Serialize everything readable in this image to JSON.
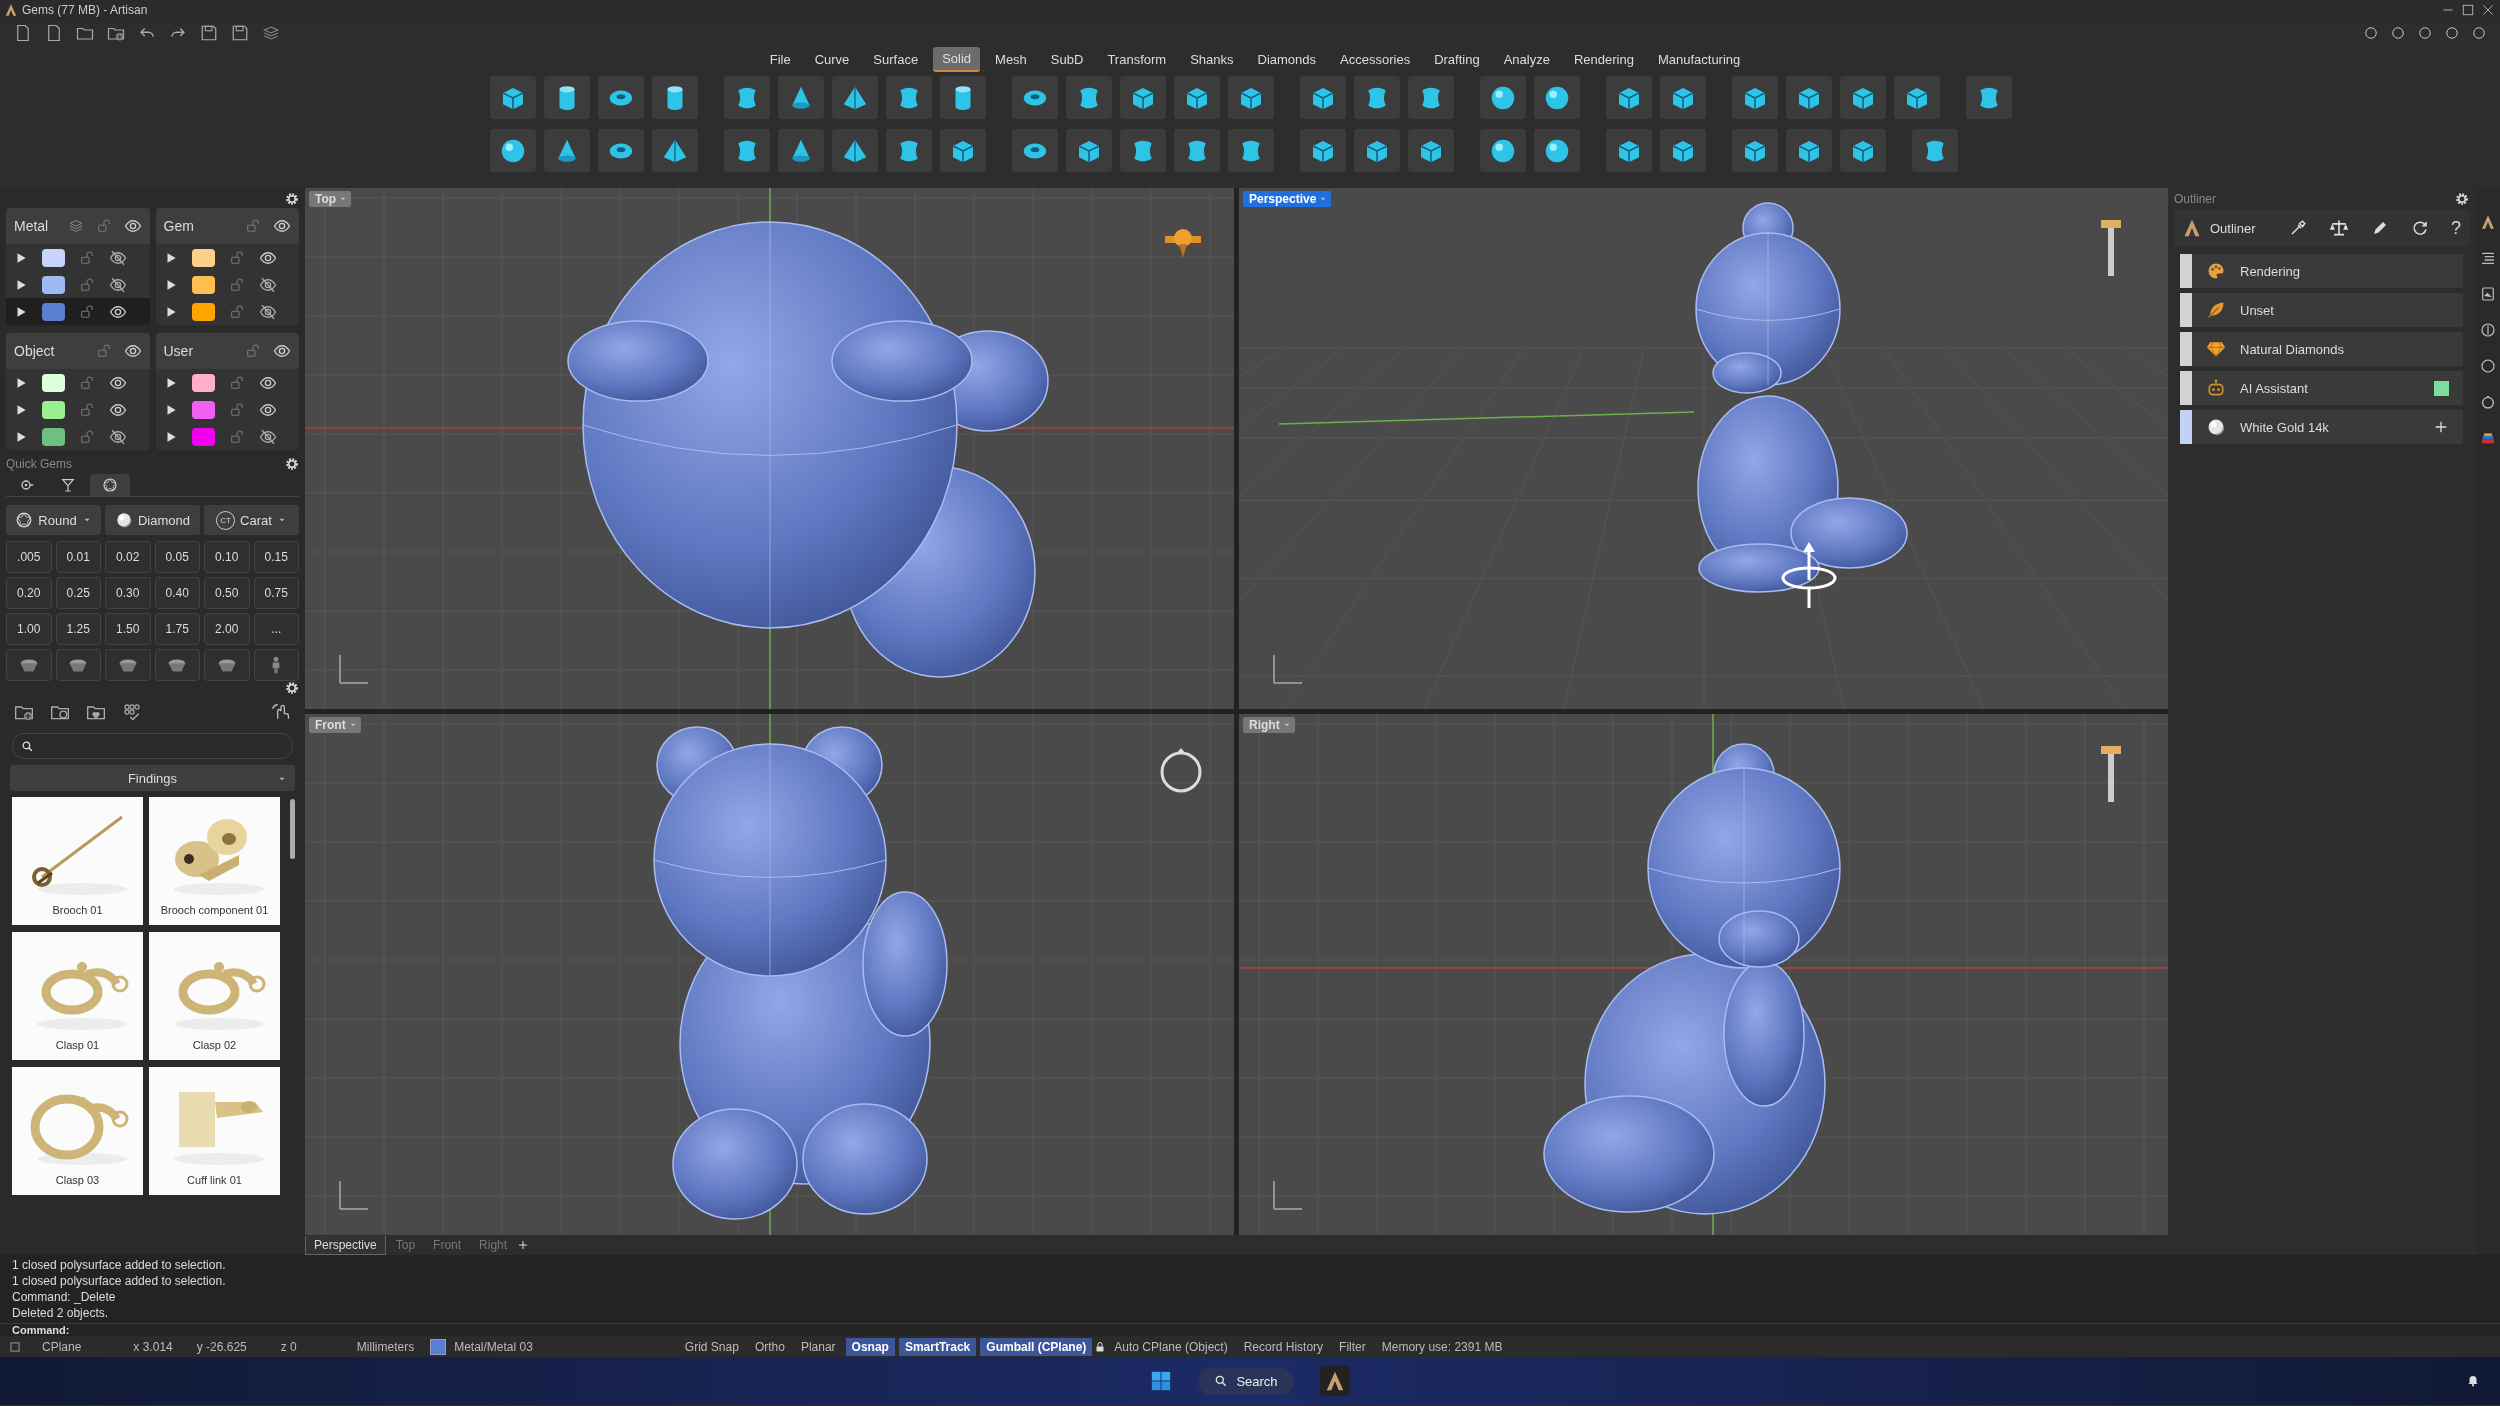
{
  "window": {
    "title": "Gems (77 MB) - Artisan"
  },
  "menu": [
    {
      "label": "File",
      "selected": false
    },
    {
      "label": "Curve",
      "selected": false
    },
    {
      "label": "Surface",
      "selected": false
    },
    {
      "label": "Solid",
      "selected": true
    },
    {
      "label": "Mesh",
      "selected": false
    },
    {
      "label": "SubD",
      "selected": false
    },
    {
      "label": "Transform",
      "selected": false
    },
    {
      "label": "Shanks",
      "selected": false
    },
    {
      "label": "Diamonds",
      "selected": false
    },
    {
      "label": "Accessories",
      "selected": false
    },
    {
      "label": "Drafting",
      "selected": false
    },
    {
      "label": "Analyze",
      "selected": false
    },
    {
      "label": "Rendering",
      "selected": false
    },
    {
      "label": "Manufacturing",
      "selected": false
    }
  ],
  "layers": {
    "groups": [
      {
        "name": "Metal",
        "layers": [
          {
            "color": "#c6d4ff",
            "visible": false,
            "selected": false
          },
          {
            "color": "#9fbaf2",
            "visible": false,
            "selected": false
          },
          {
            "color": "#5b7fd0",
            "visible": true,
            "selected": true
          }
        ]
      },
      {
        "name": "Gem",
        "layers": [
          {
            "color": "#ffd08a",
            "visible": true,
            "selected": false
          },
          {
            "color": "#ffbe50",
            "visible": false,
            "selected": false
          },
          {
            "color": "#ffa500",
            "visible": false,
            "selected": false
          }
        ]
      },
      {
        "name": "Object",
        "layers": [
          {
            "color": "#dcffdc",
            "visible": true,
            "selected": false
          },
          {
            "color": "#98f090",
            "visible": true,
            "selected": false
          },
          {
            "color": "#6cc080",
            "visible": false,
            "selected": false
          }
        ]
      },
      {
        "name": "User",
        "layers": [
          {
            "color": "#ffb0c8",
            "visible": true,
            "selected": false
          },
          {
            "color": "#f060f0",
            "visible": true,
            "selected": false
          },
          {
            "color": "#f000f0",
            "visible": false,
            "selected": false
          }
        ]
      }
    ]
  },
  "quick_gems": {
    "title": "Quick Gems",
    "tabs": [
      {
        "selected": false
      },
      {
        "selected": false
      },
      {
        "selected": true
      }
    ],
    "options": [
      {
        "kind": "cut",
        "label": "Round",
        "dropdown": true
      },
      {
        "kind": "material",
        "label": "Diamond",
        "dropdown": false
      },
      {
        "kind": "unit",
        "label": "Carat",
        "badge": "CT",
        "dropdown": true
      }
    ],
    "sizes": [
      ".005",
      "0.01",
      "0.02",
      "0.05",
      "0.10",
      "0.15",
      "0.20",
      "0.25",
      "0.30",
      "0.40",
      "0.50",
      "0.75",
      "1.00",
      "1.25",
      "1.50",
      "1.75",
      "2.00",
      "..."
    ]
  },
  "library": {
    "category": "Findings",
    "items": [
      {
        "name": "Brooch 01"
      },
      {
        "name": "Brooch component 01"
      },
      {
        "name": "Clasp 01"
      },
      {
        "name": "Clasp 02"
      },
      {
        "name": "Clasp 03"
      },
      {
        "name": "Cuff link 01"
      }
    ]
  },
  "viewports": [
    {
      "label": "Top",
      "selected": false
    },
    {
      "label": "Perspective",
      "selected": true
    },
    {
      "label": "Front",
      "selected": false
    },
    {
      "label": "Right",
      "selected": false
    }
  ],
  "view_tabs": [
    {
      "label": "Perspective",
      "selected": true
    },
    {
      "label": "Top",
      "selected": false
    },
    {
      "label": "Front",
      "selected": false
    },
    {
      "label": "Right",
      "selected": false
    }
  ],
  "outliner": {
    "panel_title": "Outliner",
    "title": "Outliner",
    "help": "?",
    "rows": [
      {
        "kind": "palette",
        "label": "Rendering",
        "color": "#d2d2d2",
        "addable": false
      },
      {
        "kind": "leaf",
        "label": "Unset",
        "color": "#d2d2d2",
        "addable": false
      },
      {
        "kind": "gem",
        "label": "Natural Diamonds",
        "color": "#d2d2d2",
        "addable": false
      },
      {
        "kind": "robot",
        "label": "AI Assistant",
        "color": "#d2d2d2",
        "swatch": {
          "color": "#7ddc9f"
        },
        "addable": false
      },
      {
        "kind": "metal",
        "label": "White Gold 14k",
        "color": "#c2d2f5",
        "addable": true
      }
    ]
  },
  "command": {
    "history": [
      "1 closed polysurface added to selection.",
      "1 closed polysurface added to selection.",
      "Command: _Delete",
      "Deleted 2 objects."
    ],
    "prompt": "Command:"
  },
  "status_bar": {
    "cplane": "CPlane",
    "x": "x 3.014",
    "y": "y -26.625",
    "z": "z 0",
    "units": "Millimeters",
    "layer": "Metal/Metal 03",
    "toggles": [
      {
        "label": "Grid Snap",
        "on": false
      },
      {
        "label": "Ortho",
        "on": false
      },
      {
        "label": "Planar",
        "on": false
      },
      {
        "label": "Osnap",
        "on": true
      },
      {
        "label": "SmartTrack",
        "on": true
      },
      {
        "label": "Gumball (CPlane)",
        "on": true
      }
    ],
    "auto_cplane": "Auto CPlane (Object)",
    "extras": [
      "Record History",
      "Filter"
    ],
    "memory": "Memory use: 2391 MB"
  },
  "taskbar": {
    "search": "Search"
  }
}
